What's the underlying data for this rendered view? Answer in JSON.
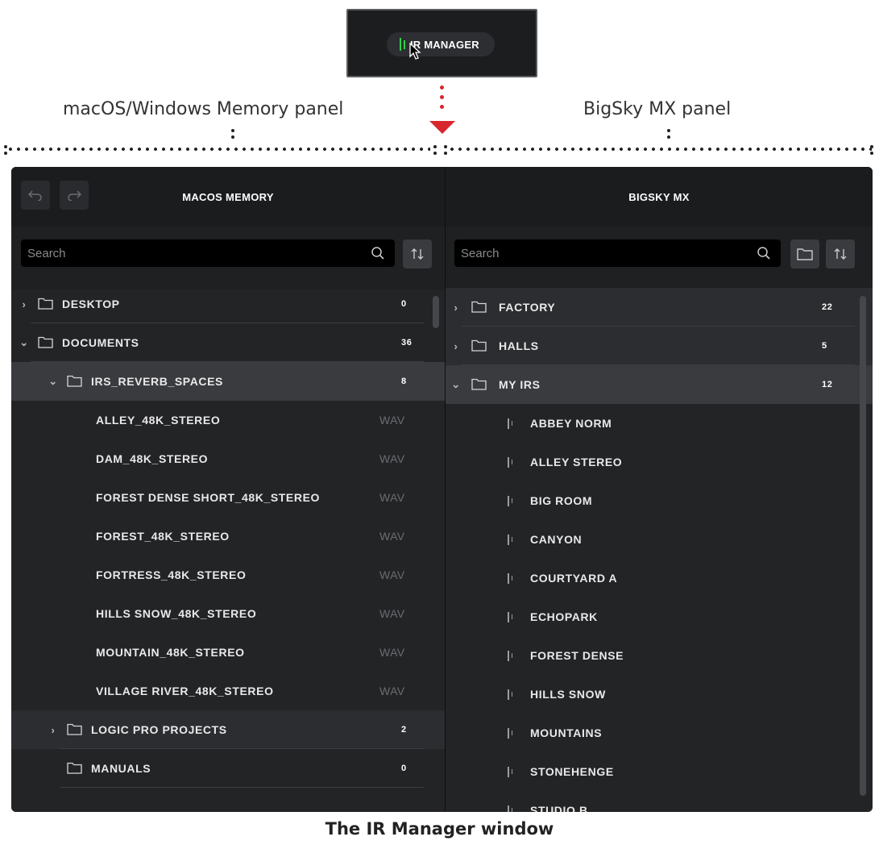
{
  "top_button": {
    "label": "IR MANAGER"
  },
  "annotations": {
    "left": "macOS/Windows Memory panel",
    "right": "BigSky MX panel",
    "caption": "The IR Manager window"
  },
  "left_panel": {
    "title": "MACOS MEMORY",
    "search_placeholder": "Search",
    "items": [
      {
        "type": "folder",
        "label": "DESKTOP",
        "count": "0",
        "expanded": false
      },
      {
        "type": "folder",
        "label": "DOCUMENTS",
        "count": "36",
        "expanded": true
      },
      {
        "type": "folder",
        "label": "IRS_REVERB_SPACES",
        "count": "8",
        "expanded": true
      },
      {
        "type": "file",
        "label": "ALLEY_48K_STEREO",
        "ext": "WAV"
      },
      {
        "type": "file",
        "label": "DAM_48K_STEREO",
        "ext": "WAV"
      },
      {
        "type": "file",
        "label": "FOREST DENSE SHORT_48K_STEREO",
        "ext": "WAV"
      },
      {
        "type": "file",
        "label": "FOREST_48K_STEREO",
        "ext": "WAV"
      },
      {
        "type": "file",
        "label": "FORTRESS_48K_STEREO",
        "ext": "WAV"
      },
      {
        "type": "file",
        "label": "HILLS SNOW_48K_STEREO",
        "ext": "WAV"
      },
      {
        "type": "file",
        "label": "MOUNTAIN_48K_STEREO",
        "ext": "WAV"
      },
      {
        "type": "file",
        "label": "VILLAGE RIVER_48K_STEREO",
        "ext": "WAV"
      },
      {
        "type": "folder",
        "label": "LOGIC PRO PROJECTS",
        "count": "2",
        "expanded": false
      },
      {
        "type": "folder",
        "label": "MANUALS",
        "count": "0",
        "expanded": false
      }
    ]
  },
  "right_panel": {
    "title": "BIGSKY MX",
    "search_placeholder": "Search",
    "items": [
      {
        "type": "folder",
        "label": "FACTORY",
        "count": "22",
        "expanded": false
      },
      {
        "type": "folder",
        "label": "HALLS",
        "count": "5",
        "expanded": false
      },
      {
        "type": "folder",
        "label": "MY IRS",
        "count": "12",
        "expanded": true
      },
      {
        "type": "ir",
        "label": "ABBEY NORM"
      },
      {
        "type": "ir",
        "label": "ALLEY STEREO"
      },
      {
        "type": "ir",
        "label": "BIG ROOM"
      },
      {
        "type": "ir",
        "label": "CANYON"
      },
      {
        "type": "ir",
        "label": "COURTYARD A"
      },
      {
        "type": "ir",
        "label": "ECHOPARK"
      },
      {
        "type": "ir",
        "label": "FOREST DENSE"
      },
      {
        "type": "ir",
        "label": "HILLS SNOW"
      },
      {
        "type": "ir",
        "label": "MOUNTAINS"
      },
      {
        "type": "ir",
        "label": "STONEHENGE"
      },
      {
        "type": "ir",
        "label": "STUDIO B"
      }
    ]
  },
  "colors": {
    "accent_green": "#33d14a",
    "arrow_red": "#d8262f"
  }
}
